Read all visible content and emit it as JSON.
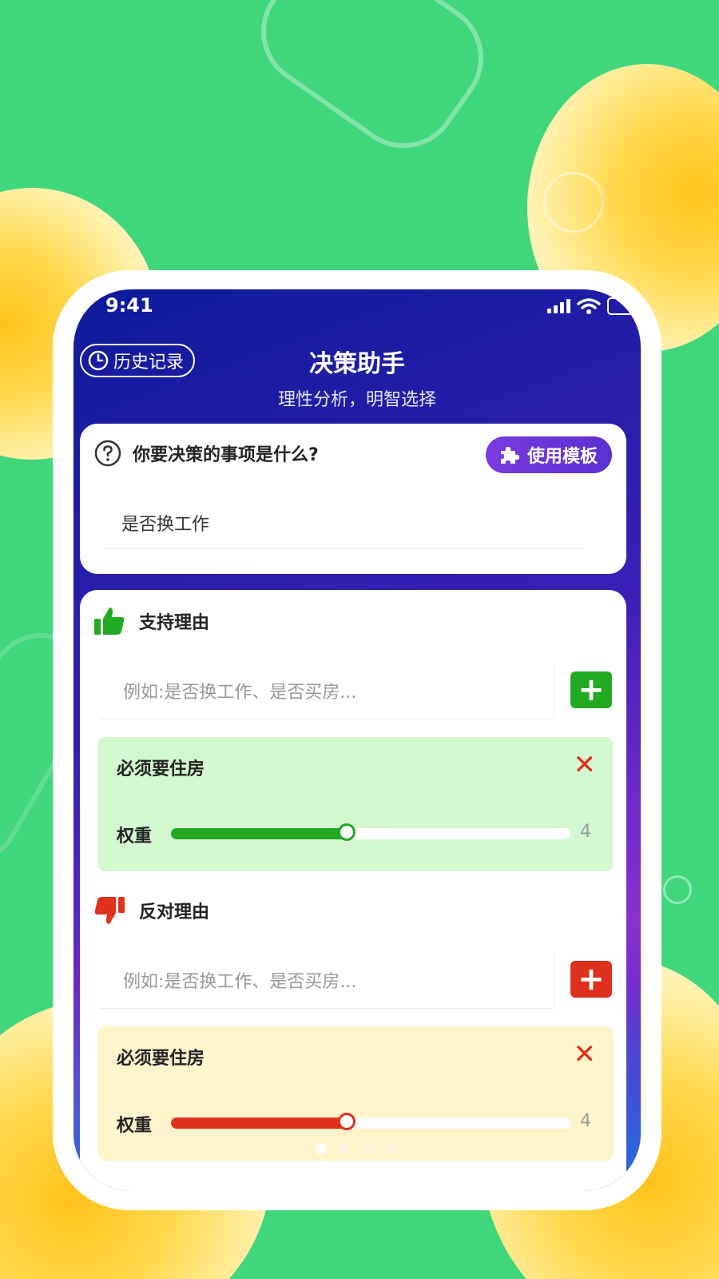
{
  "status_bar": {
    "time": "9:41"
  },
  "header": {
    "history_label": "历史记录",
    "title": "决策助手",
    "subtitle": "理性分析，明智选择"
  },
  "question": {
    "label": "你要决策的事项是什么?",
    "template_button": "使用模板",
    "value": "是否换工作"
  },
  "support": {
    "title": "支持理由",
    "input_placeholder": "例如:是否换工作、是否买房...",
    "items": [
      {
        "title": "必须要住房",
        "weight_label": "权重",
        "weight": 4,
        "weight_fraction": 0.44
      }
    ]
  },
  "oppose": {
    "title": "反对理由",
    "input_placeholder": "例如:是否换工作、是否买房...",
    "items": [
      {
        "title": "必须要住房",
        "weight_label": "权重",
        "weight": 4,
        "weight_fraction": 0.44
      }
    ]
  },
  "pagination": {
    "count": 4,
    "active": 0
  },
  "colors": {
    "support_accent": "#22aa22",
    "support_bg": "#d4f8cf",
    "oppose_accent": "#e0301e",
    "oppose_bg": "#fff4cc",
    "template_button": "#6a35d8",
    "background_green": "#3fd67c"
  },
  "icons": {
    "history": "clock-icon",
    "question": "question-circle-icon",
    "template": "puzzle-icon",
    "support": "thumbs-up-icon",
    "oppose": "thumbs-down-icon",
    "add": "plus-icon",
    "delete": "close-icon"
  }
}
